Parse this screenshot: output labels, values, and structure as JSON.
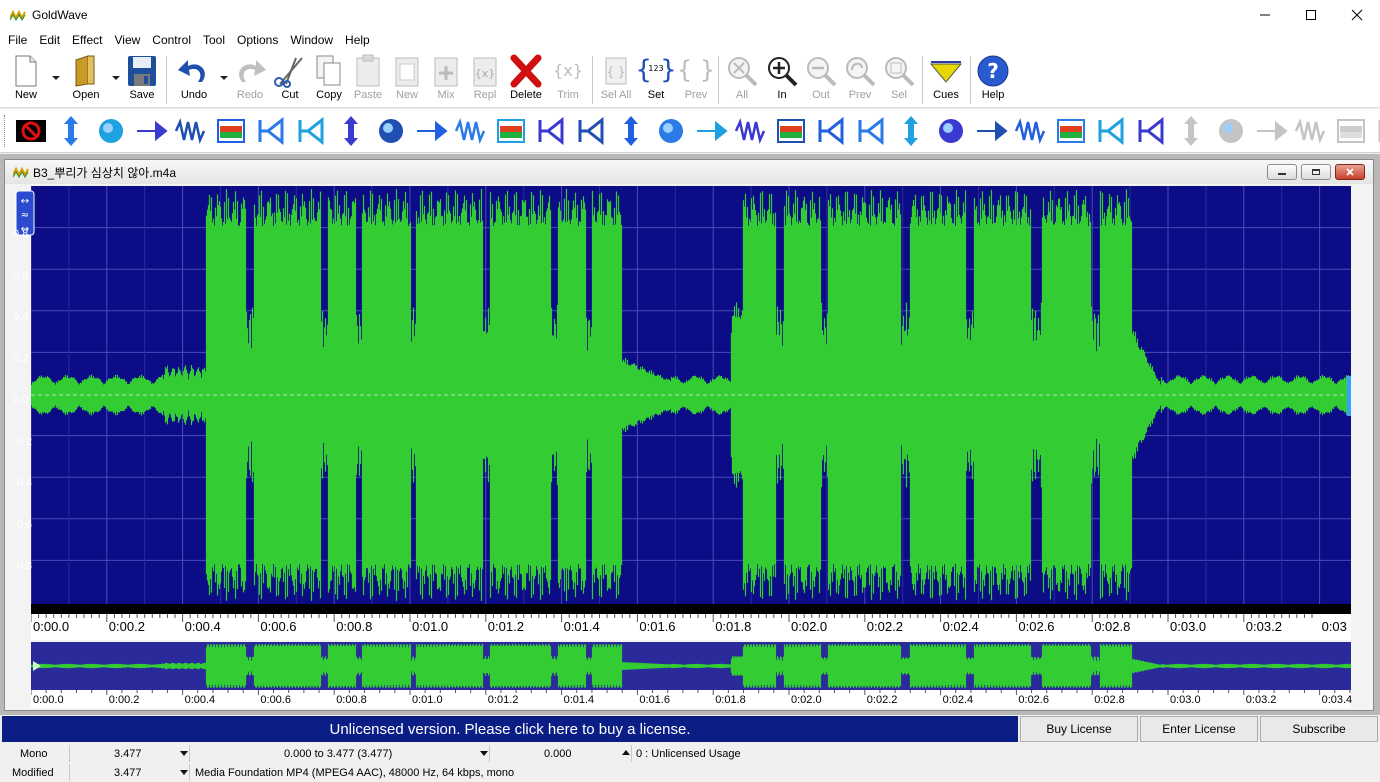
{
  "window": {
    "title": "GoldWave",
    "minimize_icon": "minimize-icon",
    "maximize_icon": "maximize-icon",
    "close_icon": "close-icon"
  },
  "menu": [
    "File",
    "Edit",
    "Effect",
    "View",
    "Control",
    "Tool",
    "Options",
    "Window",
    "Help"
  ],
  "toolbar": {
    "new": "New",
    "open": "Open",
    "save": "Save",
    "undo": "Undo",
    "redo": "Redo",
    "cut": "Cut",
    "copy": "Copy",
    "paste": "Paste",
    "paste_new": "New",
    "mix": "Mix",
    "replace": "Repl",
    "delete": "Delete",
    "trim": "Trim",
    "sel_all": "Sel All",
    "set": "Set",
    "prev": "Prev",
    "zoom_all": "All",
    "zoom_in": "In",
    "zoom_out": "Out",
    "zoom_prev": "Prev",
    "zoom_sel": "Sel",
    "cues": "Cues",
    "help": "Help",
    "set_icon_text": "123"
  },
  "effects_icons": [
    "stop-effect-icon",
    "expand-icon",
    "doppler-icon",
    "crossfade-icon",
    "dynamics-icon",
    "echo-icon",
    "flanger-icon",
    "invert-icon",
    "mechanize-icon",
    "pan-icon",
    "pitch-icon",
    "playback-rate-icon",
    "reverse-icon",
    "time-warp-icon",
    "volume-shape-icon",
    "equalizer-icon",
    "filter-bandpass-icon",
    "filter-lowpass-icon",
    "filter-spectrum-icon",
    "noise-reduction-icon",
    "click-pop-icon",
    "spectrum-filter-icon",
    "auto-gain-icon",
    "change-volume-icon",
    "fade-in-icon",
    "fade-out-icon",
    "match-volume-icon",
    "maximize-volume-icon",
    "shape-volume-icon",
    "compressor-icon",
    "silence-reduction-icon",
    "offset-icon",
    "resample-icon",
    "interpolate-icon",
    "channel-icon"
  ],
  "document": {
    "title": "B3_뿌리가 심상치 않아.m4a",
    "y_labels": [
      "0.8",
      "0.6",
      "0.4",
      "0.2",
      "0.0",
      "-0.2",
      "-0.4",
      "-0.6",
      "-0.8"
    ],
    "time_labels": [
      "0:00.0",
      "0:00.2",
      "0:00.4",
      "0:00.6",
      "0:00.8",
      "0:01.0",
      "0:01.2",
      "0:01.4",
      "0:01.6",
      "0:01.8",
      "0:02.0",
      "0:02.2",
      "0:02.4",
      "0:02.6",
      "0:02.8",
      "0:03.0",
      "0:03.2",
      "0:03"
    ],
    "overview_labels": [
      "0:00.0",
      "0:00.2",
      "0:00.4",
      "0:00.6",
      "0:00.8",
      "0:01.0",
      "0:01.2",
      "0:01.4",
      "0:01.6",
      "0:01.8",
      "0:02.0",
      "0:02.2",
      "0:02.4",
      "0:02.6",
      "0:02.8",
      "0:03.0",
      "0:03.2",
      "0:03.4"
    ],
    "colors": {
      "wave_bg": "#0c0c86",
      "wave": "#33cc33",
      "grid": "#4a4ab8"
    }
  },
  "license": {
    "message": "Unlicensed version. Please click here to buy a license.",
    "buy": "Buy License",
    "enter": "Enter License",
    "subscribe": "Subscribe"
  },
  "status": {
    "row1": {
      "channels": "Mono",
      "length": "3.477",
      "selection": "0.000 to 3.477 (3.477)",
      "position": "0.000",
      "license": "0 : Unlicensed Usage"
    },
    "row2": {
      "state": "Modified",
      "length": "3.477",
      "format": "Media Foundation MP4 (MPEG4 AAC), 48000 Hz, 64 kbps, mono"
    }
  }
}
